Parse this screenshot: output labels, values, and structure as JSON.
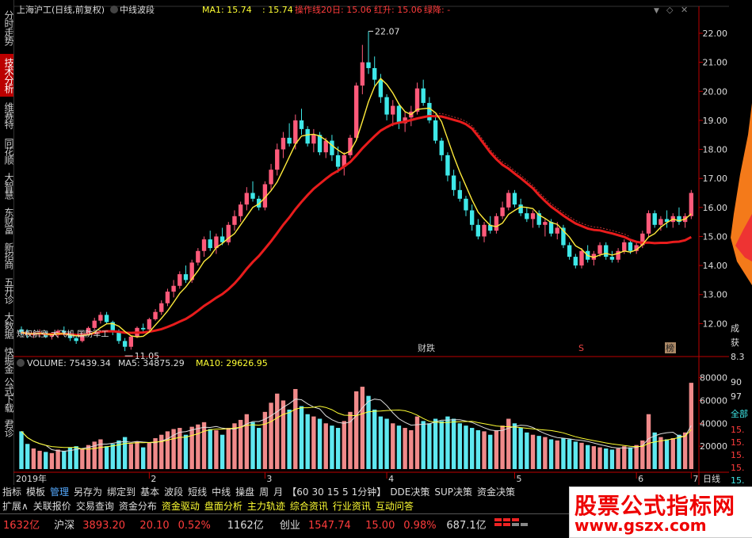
{
  "sidebar": {
    "tabs": [
      {
        "label": "分时走势",
        "active": false
      },
      {
        "label": "技术分析",
        "active": true
      },
      {
        "label": "维赛特",
        "active": false
      },
      {
        "label": "同花顺",
        "active": false
      },
      {
        "label": "大智慧",
        "active": false
      },
      {
        "label": "东财富",
        "active": false
      },
      {
        "label": "新招商",
        "active": false
      },
      {
        "label": "五开诊",
        "active": false
      },
      {
        "label": "大数据",
        "active": false
      },
      {
        "label": "快掘金",
        "active": false
      },
      {
        "label": "公式下载",
        "active": false
      },
      {
        "label": "君诊",
        "active": false
      }
    ]
  },
  "main_header": {
    "stock_name": "上海沪工(日线,前复权)",
    "indicator_name": "中线波段",
    "ma1_label": "MA1: 15.74",
    "val2": ": 15.74",
    "op_line": "操作线20日: 15.06",
    "red_rise": "红升: 15.06",
    "green_fall": "绿降: -"
  },
  "volume_header": {
    "volume": "VOLUME: 75439.34",
    "ma5": "MA5: 34875.29",
    "ma10": "MA10: 29626.95"
  },
  "price_axis": {
    "ticks": [
      "22.00",
      "21.00",
      "20.00",
      "19.00",
      "18.00",
      "17.00",
      "16.00",
      "15.00",
      "14.00",
      "13.00",
      "12.00"
    ]
  },
  "volume_axis": {
    "ticks": [
      "80000",
      "60000",
      "40000",
      "20000"
    ]
  },
  "x_axis": {
    "labels": [
      "2019年",
      "2",
      "3",
      "4",
      "5",
      "6",
      "7"
    ],
    "period": "日线"
  },
  "annotations": {
    "high": "22.07",
    "low": "11.05",
    "concept": "短权航空 大飞机 国防军工",
    "finance": "财跌",
    "tag_s": "S",
    "tag_bang": "榜"
  },
  "right_panel": {
    "labels": [
      "成",
      "获",
      "8.3",
      "90",
      "97",
      "全部",
      "15.",
      "15.",
      "15.",
      "15.",
      "15."
    ]
  },
  "bottom_toolbar": {
    "items": [
      "指标",
      "模板",
      "管理",
      "另存为",
      "绑定到",
      "基本",
      "波段",
      "短线",
      "中线",
      "操盘",
      "周",
      "月",
      "【60",
      "30",
      "15",
      "5",
      "1分钟】",
      "DDE决策",
      "SUP决策",
      "资金决策"
    ],
    "selected": "管理"
  },
  "ext_bar": {
    "items": [
      "扩展∧",
      "关联报价",
      "交易查询",
      "资金分布",
      "资金驱动",
      "盘面分析",
      "主力轨迹",
      "综合资讯",
      "行业资讯",
      "互动问答"
    ],
    "highlighted": [
      "资金驱动",
      "盘面分析",
      "主力轨迹",
      "综合资讯",
      "行业资讯",
      "互动问答"
    ]
  },
  "status_bar": {
    "amount1": "1632亿",
    "sh_label": "沪深",
    "sh_index": "3893.20",
    "sh_change": "20.10",
    "sh_pct": "0.52%",
    "amount2": "1162亿",
    "cy_label": "创业",
    "cy_index": "1547.74",
    "cy_change": "15.00",
    "cy_pct": "0.98%",
    "amount3": "687.1亿"
  },
  "watermark": {
    "title": "股票公式指标网",
    "url": "www.gszx.com"
  },
  "colors": {
    "up": "#ff5a7a",
    "down": "#3ee8e8",
    "ma1": "#ffeb3b",
    "op_line": "#e81c1c",
    "bg": "#000000"
  },
  "chart_data": {
    "type": "candlestick",
    "ylim": [
      11,
      22.6
    ],
    "volume_ylim": [
      0,
      88000
    ],
    "candles": [
      [
        11.8,
        11.9,
        11.6,
        11.7,
        33000
      ],
      [
        11.7,
        11.8,
        11.5,
        11.6,
        22000
      ],
      [
        11.6,
        11.7,
        11.5,
        11.65,
        18000
      ],
      [
        11.65,
        11.8,
        11.55,
        11.7,
        16000
      ],
      [
        11.7,
        11.75,
        11.5,
        11.55,
        15000
      ],
      [
        11.55,
        11.7,
        11.45,
        11.6,
        14000
      ],
      [
        11.6,
        11.8,
        11.5,
        11.75,
        17000
      ],
      [
        11.75,
        11.9,
        11.6,
        11.65,
        16000
      ],
      [
        11.65,
        11.7,
        11.4,
        11.5,
        19000
      ],
      [
        11.5,
        11.6,
        11.3,
        11.4,
        20000
      ],
      [
        11.4,
        11.7,
        11.35,
        11.65,
        18000
      ],
      [
        11.65,
        11.9,
        11.6,
        11.85,
        21000
      ],
      [
        11.85,
        12.2,
        11.8,
        12.1,
        24000
      ],
      [
        12.1,
        12.4,
        12.0,
        12.3,
        26000
      ],
      [
        12.3,
        12.4,
        12.0,
        12.05,
        20000
      ],
      [
        12.05,
        12.1,
        11.6,
        11.7,
        22000
      ],
      [
        11.7,
        11.8,
        11.3,
        11.4,
        25000
      ],
      [
        11.4,
        11.5,
        11.05,
        11.2,
        28000
      ],
      [
        11.2,
        11.6,
        11.1,
        11.55,
        22000
      ],
      [
        11.55,
        11.9,
        11.5,
        11.85,
        24000
      ],
      [
        11.85,
        12.0,
        11.7,
        11.8,
        19000
      ],
      [
        11.8,
        12.2,
        11.75,
        12.15,
        23000
      ],
      [
        12.15,
        12.5,
        12.1,
        12.4,
        27000
      ],
      [
        12.4,
        12.8,
        12.3,
        12.7,
        30000
      ],
      [
        12.7,
        13.2,
        12.6,
        13.1,
        33000
      ],
      [
        13.1,
        13.5,
        12.9,
        13.3,
        35000
      ],
      [
        13.3,
        13.8,
        13.2,
        13.7,
        36000
      ],
      [
        13.7,
        14.0,
        13.4,
        13.5,
        30000
      ],
      [
        13.5,
        14.2,
        13.4,
        14.1,
        37000
      ],
      [
        14.1,
        14.6,
        14.0,
        14.5,
        39000
      ],
      [
        14.5,
        15.0,
        14.3,
        14.9,
        41000
      ],
      [
        14.9,
        15.2,
        14.5,
        14.6,
        35000
      ],
      [
        14.6,
        15.1,
        14.4,
        15.0,
        34000
      ],
      [
        15.0,
        15.3,
        14.7,
        14.8,
        30000
      ],
      [
        14.8,
        15.5,
        14.7,
        15.4,
        36000
      ],
      [
        15.4,
        15.9,
        15.2,
        15.7,
        40000
      ],
      [
        15.7,
        16.2,
        15.5,
        16.1,
        43000
      ],
      [
        16.1,
        16.7,
        15.9,
        16.5,
        48000
      ],
      [
        16.5,
        16.9,
        16.2,
        16.3,
        41000
      ],
      [
        16.3,
        16.4,
        15.9,
        16.0,
        36000
      ],
      [
        16.0,
        16.9,
        15.9,
        16.8,
        50000
      ],
      [
        16.8,
        17.5,
        16.6,
        17.3,
        58000
      ],
      [
        17.3,
        18.2,
        17.1,
        18.0,
        66000
      ],
      [
        18.0,
        18.6,
        17.7,
        18.4,
        60000
      ],
      [
        18.4,
        18.9,
        18.1,
        18.2,
        52000
      ],
      [
        18.2,
        19.2,
        18.0,
        19.0,
        70000
      ],
      [
        19.0,
        19.4,
        18.5,
        18.7,
        55000
      ],
      [
        18.7,
        18.8,
        18.1,
        18.2,
        48000
      ],
      [
        18.2,
        18.7,
        17.9,
        18.5,
        46000
      ],
      [
        18.5,
        18.6,
        17.8,
        17.9,
        44000
      ],
      [
        17.9,
        18.4,
        17.7,
        18.3,
        40000
      ],
      [
        18.3,
        18.5,
        17.6,
        17.8,
        38000
      ],
      [
        17.8,
        18.1,
        17.2,
        17.4,
        36000
      ],
      [
        17.4,
        17.9,
        17.1,
        17.8,
        42000
      ],
      [
        17.8,
        18.5,
        17.7,
        18.4,
        50000
      ],
      [
        18.4,
        20.3,
        18.3,
        20.2,
        68000
      ],
      [
        20.2,
        21.6,
        19.9,
        21.0,
        72000
      ],
      [
        21.0,
        22.07,
        20.6,
        20.8,
        64000
      ],
      [
        20.8,
        21.2,
        20.2,
        20.4,
        52000
      ],
      [
        20.4,
        20.6,
        19.6,
        19.8,
        46000
      ],
      [
        19.8,
        19.9,
        19.0,
        19.2,
        44000
      ],
      [
        19.2,
        19.7,
        18.8,
        19.5,
        40000
      ],
      [
        19.5,
        19.6,
        18.7,
        18.9,
        38000
      ],
      [
        18.9,
        19.3,
        18.6,
        19.1,
        36000
      ],
      [
        19.1,
        19.5,
        18.8,
        19.3,
        34000
      ],
      [
        19.3,
        20.3,
        19.2,
        20.1,
        46000
      ],
      [
        20.1,
        20.4,
        19.5,
        19.6,
        42000
      ],
      [
        19.6,
        19.8,
        18.9,
        19.0,
        40000
      ],
      [
        19.0,
        19.2,
        18.2,
        18.3,
        44000
      ],
      [
        18.3,
        18.4,
        17.6,
        17.8,
        42000
      ],
      [
        17.8,
        17.9,
        16.9,
        17.1,
        46000
      ],
      [
        17.1,
        17.3,
        16.4,
        16.6,
        44000
      ],
      [
        16.6,
        16.9,
        16.2,
        16.3,
        40000
      ],
      [
        16.3,
        16.4,
        15.7,
        15.9,
        38000
      ],
      [
        15.9,
        16.1,
        15.2,
        15.4,
        36000
      ],
      [
        15.4,
        15.6,
        14.9,
        15.0,
        34000
      ],
      [
        15.0,
        15.5,
        14.8,
        15.4,
        33000
      ],
      [
        15.4,
        15.7,
        15.1,
        15.2,
        30000
      ],
      [
        15.2,
        15.8,
        15.1,
        15.7,
        34000
      ],
      [
        15.7,
        16.2,
        15.6,
        16.0,
        38000
      ],
      [
        16.0,
        16.6,
        15.9,
        16.5,
        44000
      ],
      [
        16.5,
        16.6,
        16.0,
        16.1,
        40000
      ],
      [
        16.1,
        16.3,
        15.7,
        15.8,
        36000
      ],
      [
        15.8,
        16.0,
        15.5,
        15.6,
        32000
      ],
      [
        15.6,
        15.9,
        15.3,
        15.8,
        30000
      ],
      [
        15.8,
        15.9,
        15.3,
        15.4,
        29000
      ],
      [
        15.4,
        15.6,
        15.0,
        15.5,
        28000
      ],
      [
        15.5,
        15.6,
        15.0,
        15.1,
        26000
      ],
      [
        15.1,
        15.5,
        14.9,
        15.3,
        25000
      ],
      [
        15.3,
        15.4,
        14.6,
        14.7,
        27000
      ],
      [
        14.7,
        14.8,
        14.2,
        14.3,
        26000
      ],
      [
        14.3,
        14.4,
        13.9,
        14.0,
        24000
      ],
      [
        14.0,
        14.6,
        13.9,
        14.5,
        23000
      ],
      [
        14.5,
        14.7,
        14.1,
        14.2,
        21000
      ],
      [
        14.2,
        14.5,
        14.0,
        14.4,
        20000
      ],
      [
        14.4,
        14.8,
        14.3,
        14.7,
        19000
      ],
      [
        14.7,
        14.8,
        14.2,
        14.3,
        18000
      ],
      [
        14.3,
        14.5,
        14.1,
        14.2,
        17000
      ],
      [
        14.2,
        14.6,
        14.1,
        14.5,
        18000
      ],
      [
        14.5,
        14.9,
        14.4,
        14.8,
        20000
      ],
      [
        14.8,
        14.9,
        14.4,
        14.5,
        19000
      ],
      [
        14.5,
        14.8,
        14.4,
        14.7,
        21000
      ],
      [
        14.7,
        15.2,
        14.6,
        15.1,
        25000
      ],
      [
        15.1,
        15.9,
        15.0,
        15.8,
        48000
      ],
      [
        15.8,
        15.9,
        15.3,
        15.4,
        32000
      ],
      [
        15.4,
        15.7,
        15.2,
        15.6,
        28000
      ],
      [
        15.6,
        15.9,
        15.3,
        15.5,
        26000
      ],
      [
        15.5,
        15.8,
        15.3,
        15.7,
        27000
      ],
      [
        15.7,
        16.0,
        15.4,
        15.5,
        30000
      ],
      [
        15.5,
        15.8,
        15.3,
        15.7,
        32000
      ],
      [
        15.7,
        16.6,
        15.6,
        16.5,
        75439
      ]
    ]
  }
}
